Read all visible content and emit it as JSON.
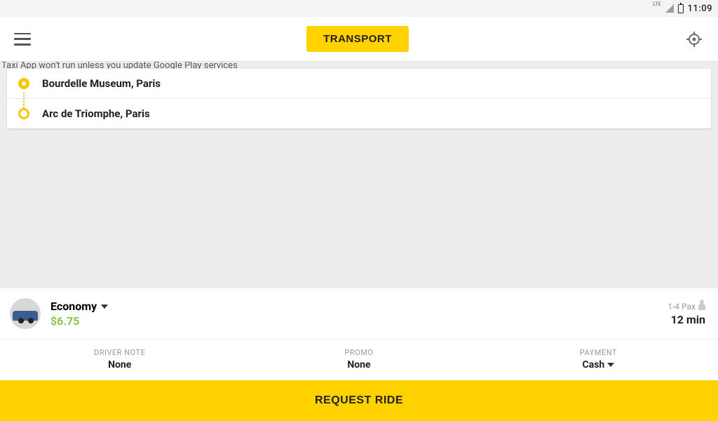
{
  "statusbar": {
    "network": "LTE",
    "time": "11:09"
  },
  "header": {
    "title": "TRANSPORT"
  },
  "warning": "Taxi App won't run unless you update Google Play services",
  "route": {
    "origin": "Bourdelle Museum, Paris",
    "destination": "Arc de Triomphe, Paris"
  },
  "ride": {
    "class": "Economy",
    "price": "$6.75",
    "pax": "1-4 Pax",
    "eta": "12 min"
  },
  "options": {
    "driver_note": {
      "label": "DRIVER NOTE",
      "value": "None"
    },
    "promo": {
      "label": "PROMO",
      "value": "None"
    },
    "payment": {
      "label": "PAYMENT",
      "value": "Cash"
    }
  },
  "cta": "REQUEST RIDE"
}
